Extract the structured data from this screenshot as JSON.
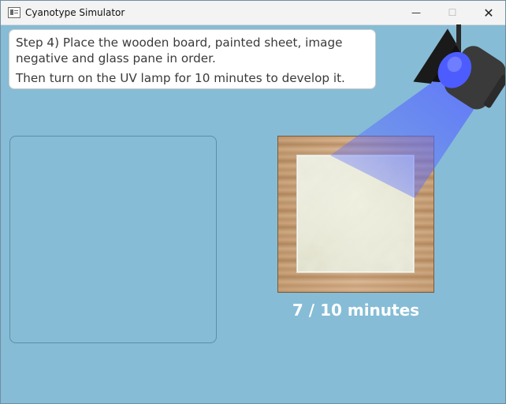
{
  "window": {
    "title": "Cyanotype Simulator",
    "minimize_glyph": "—",
    "maximize_glyph": "☐",
    "close_glyph": "✕"
  },
  "instruction": {
    "line1": "Step 4) Place the wooden board, painted sheet, image negative and glass pane in order.",
    "line2": "Then turn on the UV lamp for 10 minutes to develop it."
  },
  "timer": {
    "text": "7 / 10 minutes",
    "elapsed_minutes": 7,
    "total_minutes": 10
  },
  "icons": {
    "lamp": "uv-spotlight-icon",
    "app": "window-app-icon"
  },
  "colors": {
    "background": "#86bcd6",
    "uv_light": "#5a6cff",
    "wood": "#c59c73"
  }
}
